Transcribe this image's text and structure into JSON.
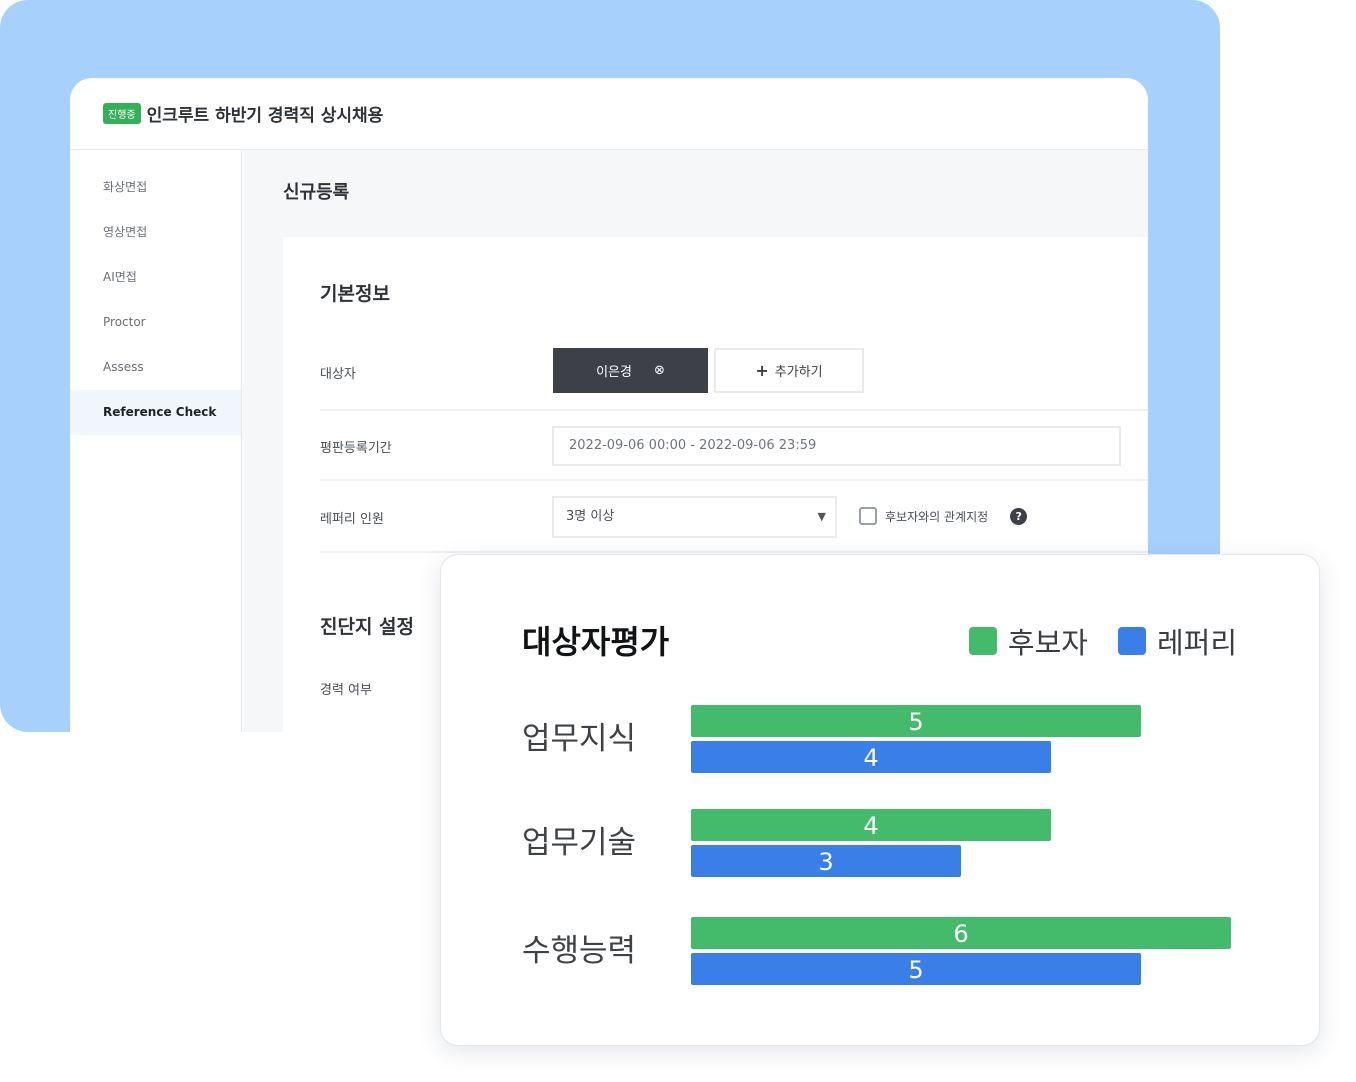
{
  "app": {
    "status_badge": "진행중",
    "title": "인크루트 하반기 경력직 상시채용"
  },
  "sidebar": {
    "items": [
      {
        "label": "화상면접"
      },
      {
        "label": "영상면접"
      },
      {
        "label": "AI면접"
      },
      {
        "label": "Proctor"
      },
      {
        "label": "Assess"
      },
      {
        "label": "Reference Check",
        "active": true
      }
    ]
  },
  "main": {
    "page_title": "신규등록",
    "basic_info": {
      "title": "기본정보",
      "target_label": "대상자",
      "target_person": "이은경",
      "add_button": "추가하기",
      "period_label": "평판등록기간",
      "period_value": "2022-09-06 00:00 - 2022-09-06 23:59",
      "referee_label": "레퍼리 인원",
      "referee_selected": "3명 이상",
      "relation_checkbox": "후보자와의 관계지정",
      "relation_checked": false
    },
    "diagnosis": {
      "title": "진단지 설정",
      "career_label": "경력 여부"
    }
  },
  "eval": {
    "title": "대상자평가",
    "legend": {
      "candidate": "후보자",
      "referee": "레퍼리"
    }
  },
  "colors": {
    "candidate": "#43bb6a",
    "referee": "#3a7ee8",
    "background_panel": "#a7d1fc"
  },
  "chart_data": {
    "type": "bar",
    "orientation": "horizontal",
    "title": "대상자평가",
    "categories": [
      "업무지식",
      "업무기술",
      "수행능력"
    ],
    "series": [
      {
        "name": "후보자",
        "values": [
          5,
          4,
          6
        ]
      },
      {
        "name": "레퍼리",
        "values": [
          4,
          3,
          5
        ]
      }
    ],
    "data_labels": true,
    "xlim": [
      0,
      6
    ],
    "grid": false,
    "legend_position": "top-right"
  }
}
